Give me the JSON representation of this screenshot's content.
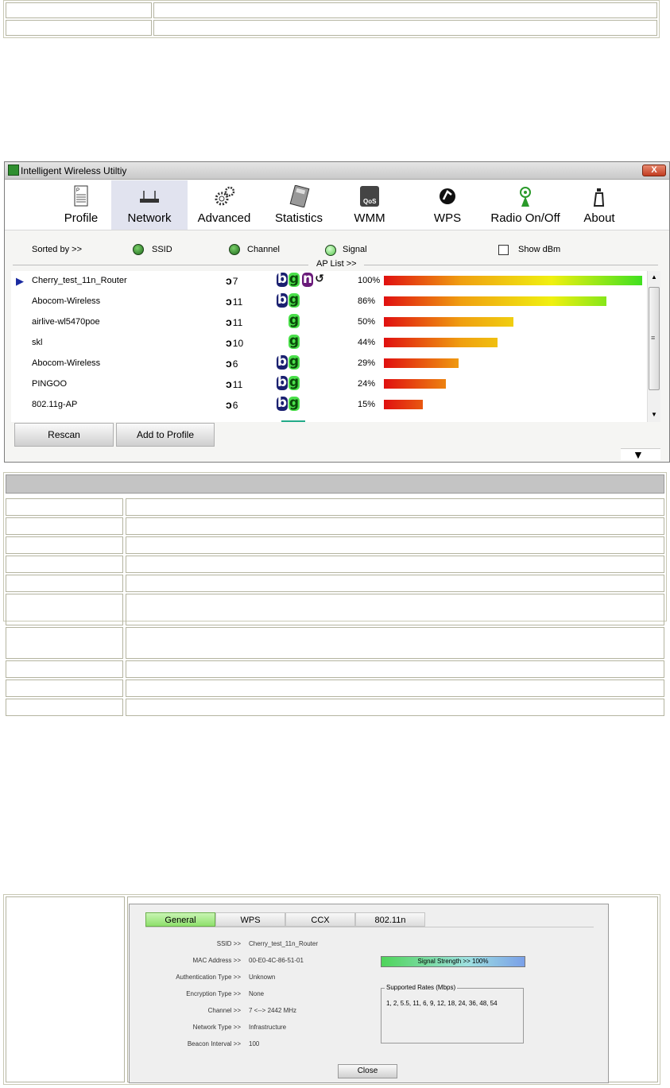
{
  "window": {
    "title": "Intelligent Wireless Utiltiy",
    "close_label": "X"
  },
  "toolbar": {
    "items": [
      {
        "label": "Profile",
        "icon": "profile-icon"
      },
      {
        "label": "Network",
        "icon": "router-icon"
      },
      {
        "label": "Advanced",
        "icon": "gears-icon"
      },
      {
        "label": "Statistics",
        "icon": "calculator-icon"
      },
      {
        "label": "WMM",
        "icon": "qos-icon"
      },
      {
        "label": "WPS",
        "icon": "wps-icon"
      },
      {
        "label": "Radio On/Off",
        "icon": "radio-icon"
      },
      {
        "label": "About",
        "icon": "about-icon"
      }
    ],
    "active": "Network"
  },
  "sort": {
    "label": "Sorted by >>",
    "options": [
      "SSID",
      "Channel",
      "Signal"
    ],
    "selected": "Signal",
    "show_dbm": "Show dBm",
    "ap_list": "AP List >>"
  },
  "ap_list": [
    {
      "ssid": "Cherry_test_11n_Router",
      "channel": "7",
      "modes": [
        "b",
        "g",
        "n",
        "wps"
      ],
      "signal": "100%",
      "level": 1.0
    },
    {
      "ssid": "Abocom-Wireless",
      "channel": "11",
      "modes": [
        "b",
        "g"
      ],
      "signal": "86%",
      "level": 0.86
    },
    {
      "ssid": "airlive-wl5470poe",
      "channel": "11",
      "modes": [
        "g"
      ],
      "signal": "50%",
      "level": 0.5
    },
    {
      "ssid": "skl",
      "channel": "10",
      "modes": [
        "g"
      ],
      "signal": "44%",
      "level": 0.44
    },
    {
      "ssid": "Abocom-Wireless",
      "channel": "6",
      "modes": [
        "b",
        "g"
      ],
      "signal": "29%",
      "level": 0.29
    },
    {
      "ssid": "PINGOO",
      "channel": "11",
      "modes": [
        "b",
        "g"
      ],
      "signal": "24%",
      "level": 0.24
    },
    {
      "ssid": "802.11g-AP",
      "channel": "6",
      "modes": [
        "b",
        "g"
      ],
      "signal": "15%",
      "level": 0.15
    }
  ],
  "buttons": {
    "rescan": "Rescan",
    "add_profile": "Add to Profile"
  },
  "details": {
    "tabs": [
      "General",
      "WPS",
      "CCX",
      "802.11n"
    ],
    "fields": [
      {
        "label": "SSID >>",
        "value": "Cherry_test_11n_Router"
      },
      {
        "label": "MAC Address >>",
        "value": "00-E0-4C-86-51-01"
      },
      {
        "label": "Authentication Type >>",
        "value": "Unknown"
      },
      {
        "label": "Encryption Type >>",
        "value": "None"
      },
      {
        "label": "Channel >>",
        "value": "7 <--> 2442 MHz"
      },
      {
        "label": "Network Type >>",
        "value": "Infrastructure"
      },
      {
        "label": "Beacon Interval >>",
        "value": "100"
      }
    ],
    "signal_strength": "Signal Strength >> 100%",
    "rates_title": "Supported Rates (Mbps)",
    "rates": "1, 2, 5.5, 11, 6, 9, 12, 18, 24, 36, 48, 54",
    "close": "Close"
  }
}
